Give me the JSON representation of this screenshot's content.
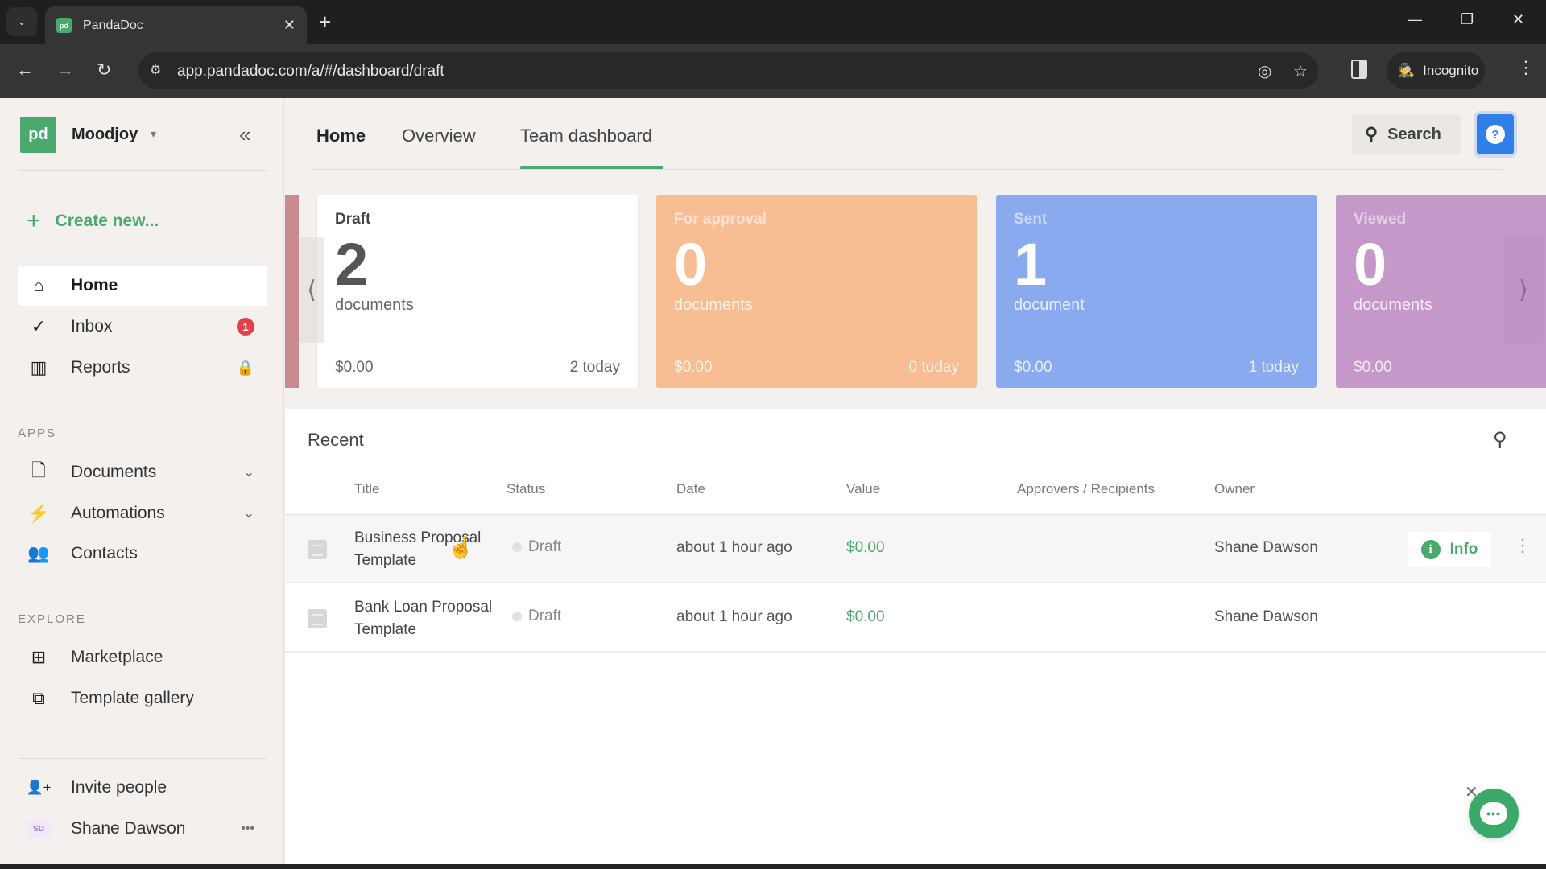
{
  "browser": {
    "tab_title": "PandaDoc",
    "favicon_text": "pd",
    "url": "app.pandadoc.com/a/#/dashboard/draft",
    "incognito_label": "Incognito",
    "icons": {
      "tab_dropdown": "⌄",
      "close": "✕",
      "new_tab": "+",
      "minimize": "—",
      "restore": "❐",
      "window_close": "✕",
      "back": "←",
      "forward": "→",
      "reload": "↻",
      "site_settings": "⚙",
      "eye_off": "◎",
      "star": "☆",
      "incognito": "🕵",
      "menu": "⋮"
    }
  },
  "sidebar": {
    "logo_text": "pd",
    "workspace": "Moodjoy",
    "workspace_caret": "▾",
    "collapse_icon": "«",
    "create_new": "Create new...",
    "create_plus": "+",
    "nav": [
      {
        "label": "Home",
        "icon": "⌂",
        "active": true
      },
      {
        "label": "Inbox",
        "icon": "✓",
        "badge": "1"
      },
      {
        "label": "Reports",
        "icon": "▥",
        "locked": true
      }
    ],
    "lock_icon": "🔒",
    "apps_label": "APPS",
    "apps": [
      {
        "label": "Documents",
        "icon": "🗋",
        "chevron": "⌄"
      },
      {
        "label": "Automations",
        "icon": "⚡",
        "chevron": "⌄"
      },
      {
        "label": "Contacts",
        "icon": "👥"
      }
    ],
    "explore_label": "EXPLORE",
    "explore": [
      {
        "label": "Marketplace",
        "icon": "⊞"
      },
      {
        "label": "Template gallery",
        "icon": "⧉"
      }
    ],
    "invite": {
      "label": "Invite people",
      "icon": "👤+"
    },
    "user": {
      "initials": "SD",
      "name": "Shane Dawson",
      "more": "•••"
    }
  },
  "header": {
    "tabs": [
      {
        "label": "Home"
      },
      {
        "label": "Overview"
      },
      {
        "label": "Team dashboard",
        "active": true
      }
    ],
    "search_label": "Search",
    "search_icon": "⚲",
    "help_icon": "?"
  },
  "cards": [
    {
      "label": "Draft",
      "count": "2",
      "unit": "documents",
      "value": "$0.00",
      "today": "2 today",
      "color": "#ffffff"
    },
    {
      "label": "For approval",
      "count": "0",
      "unit": "documents",
      "value": "$0.00",
      "today": "0 today",
      "color": "#f7be94"
    },
    {
      "label": "Sent",
      "count": "1",
      "unit": "document",
      "value": "$0.00",
      "today": "1 today",
      "color": "#8aaaf0"
    },
    {
      "label": "Viewed",
      "count": "0",
      "unit": "documents",
      "value": "$0.00",
      "today": "",
      "color": "#c498c8"
    }
  ],
  "carousel": {
    "prev": "⟨",
    "next": "⟩"
  },
  "recent": {
    "title": "Recent",
    "search_icon": "⚲",
    "columns": [
      "Title",
      "Status",
      "Date",
      "Value",
      "Approvers / Recipients",
      "Owner"
    ],
    "rows": [
      {
        "title": "Business Proposal Template",
        "status": "Draft",
        "date": "about 1 hour ago",
        "value": "$0.00",
        "recipients": "",
        "owner": "Shane Dawson",
        "info": "Info"
      },
      {
        "title": "Bank Loan Proposal Template",
        "status": "Draft",
        "date": "about 1 hour ago",
        "value": "$0.00",
        "recipients": "",
        "owner": "Shane Dawson"
      }
    ],
    "info_icon": "i",
    "row_menu": "⋮"
  },
  "chat": {
    "close": "✕",
    "bubble": "•••"
  },
  "cursor": "☝"
}
